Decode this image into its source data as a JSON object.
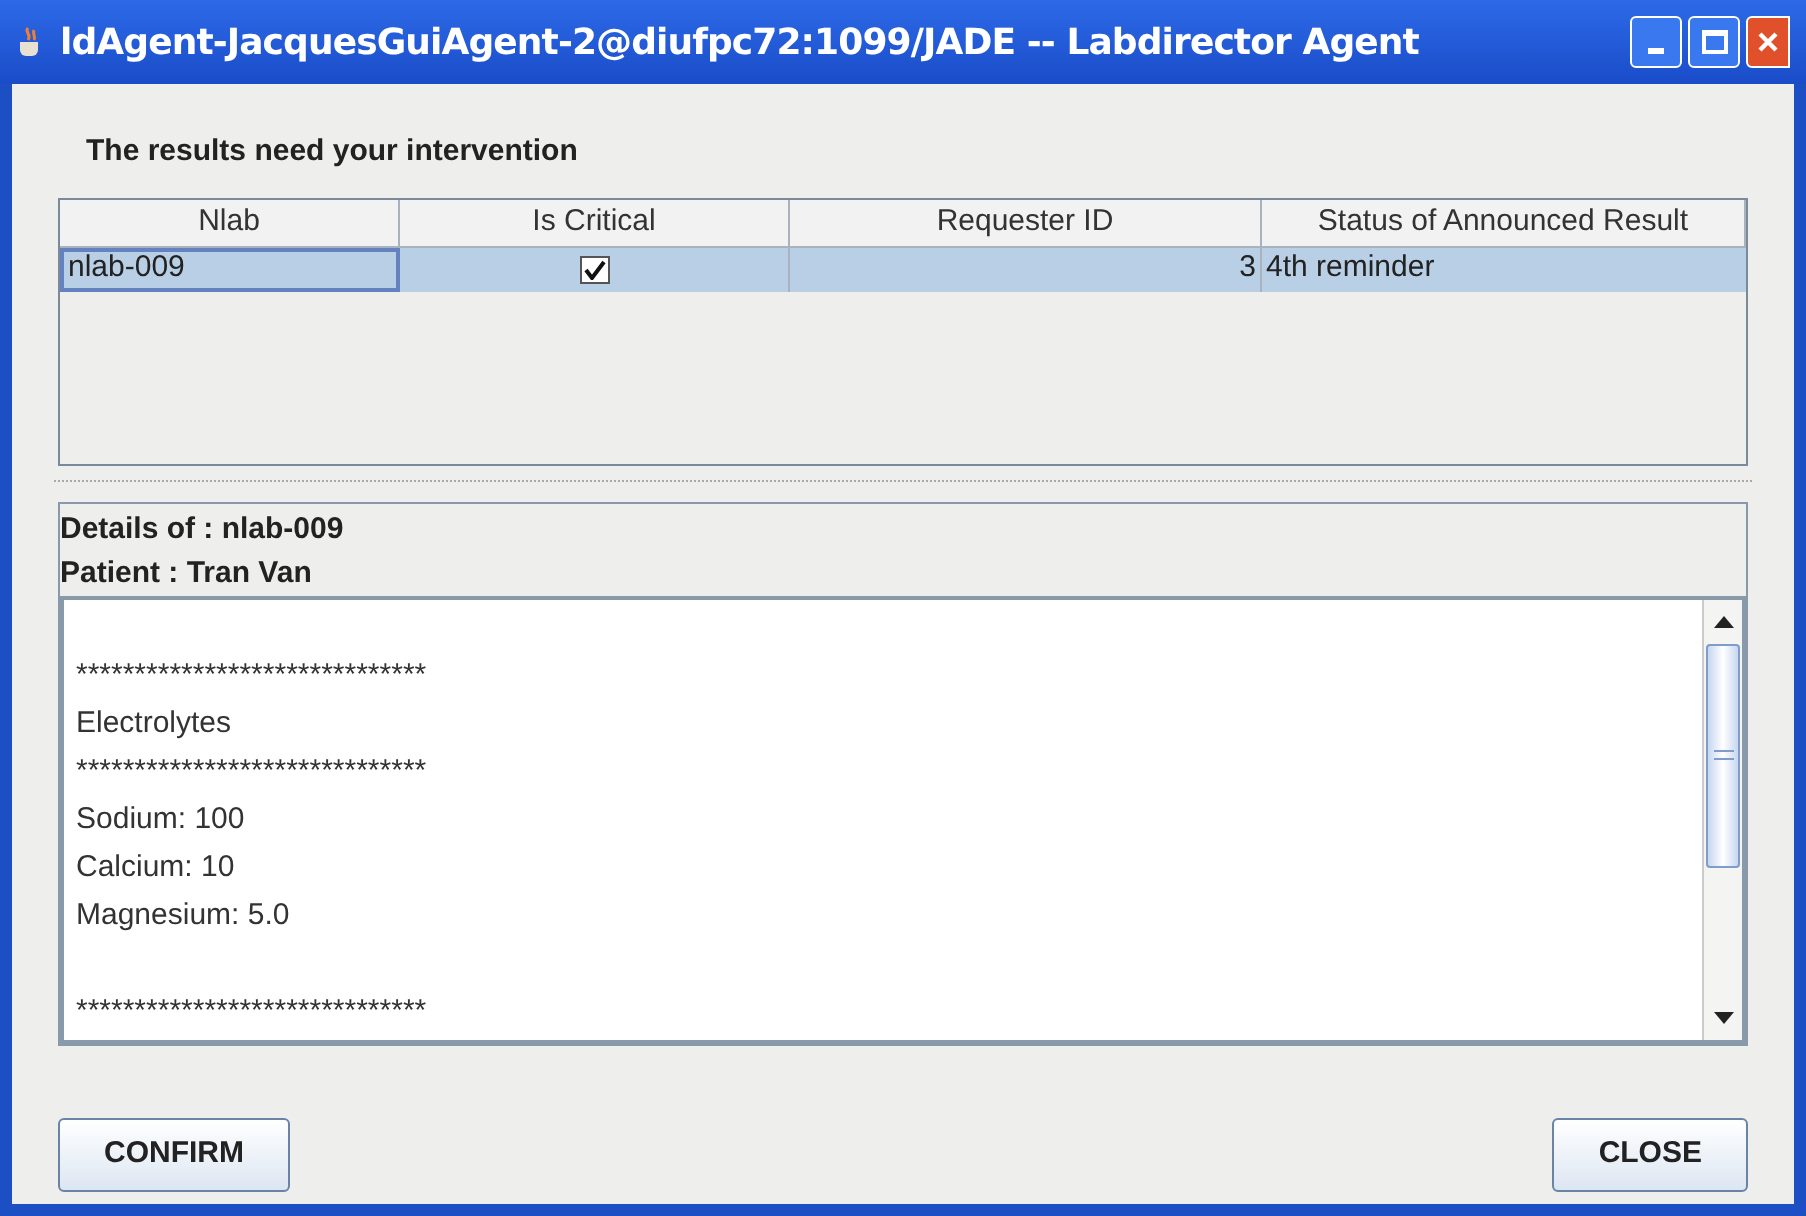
{
  "window": {
    "title": "ldAgent-JacquesGuiAgent-2@diufpc72:1099/JADE -- Labdirector Agent"
  },
  "heading": "The results need your intervention",
  "table": {
    "columns": [
      "Nlab",
      "Is Critical",
      "Requester ID",
      "Status of Announced Result"
    ],
    "rows": [
      {
        "nlab": "nlab-009",
        "critical": true,
        "requester": "3",
        "status": "4th reminder",
        "selected": true
      }
    ]
  },
  "details": {
    "title": "Details of : nlab-009",
    "patient": "Patient : Tran Van",
    "lines": [
      {
        "kind": "blank"
      },
      {
        "kind": "text",
        "text": "******************************"
      },
      {
        "kind": "text",
        "text": "Electrolytes"
      },
      {
        "kind": "text",
        "text": "******************************"
      },
      {
        "kind": "text",
        "text": "Sodium: 100"
      },
      {
        "kind": "text",
        "text": "Calcium: 10"
      },
      {
        "kind": "text",
        "text": "Magnesium: 5.0"
      },
      {
        "kind": "blank"
      },
      {
        "kind": "text",
        "text": "******************************"
      }
    ]
  },
  "buttons": [
    "CONFIRM",
    "CLOSE"
  ]
}
